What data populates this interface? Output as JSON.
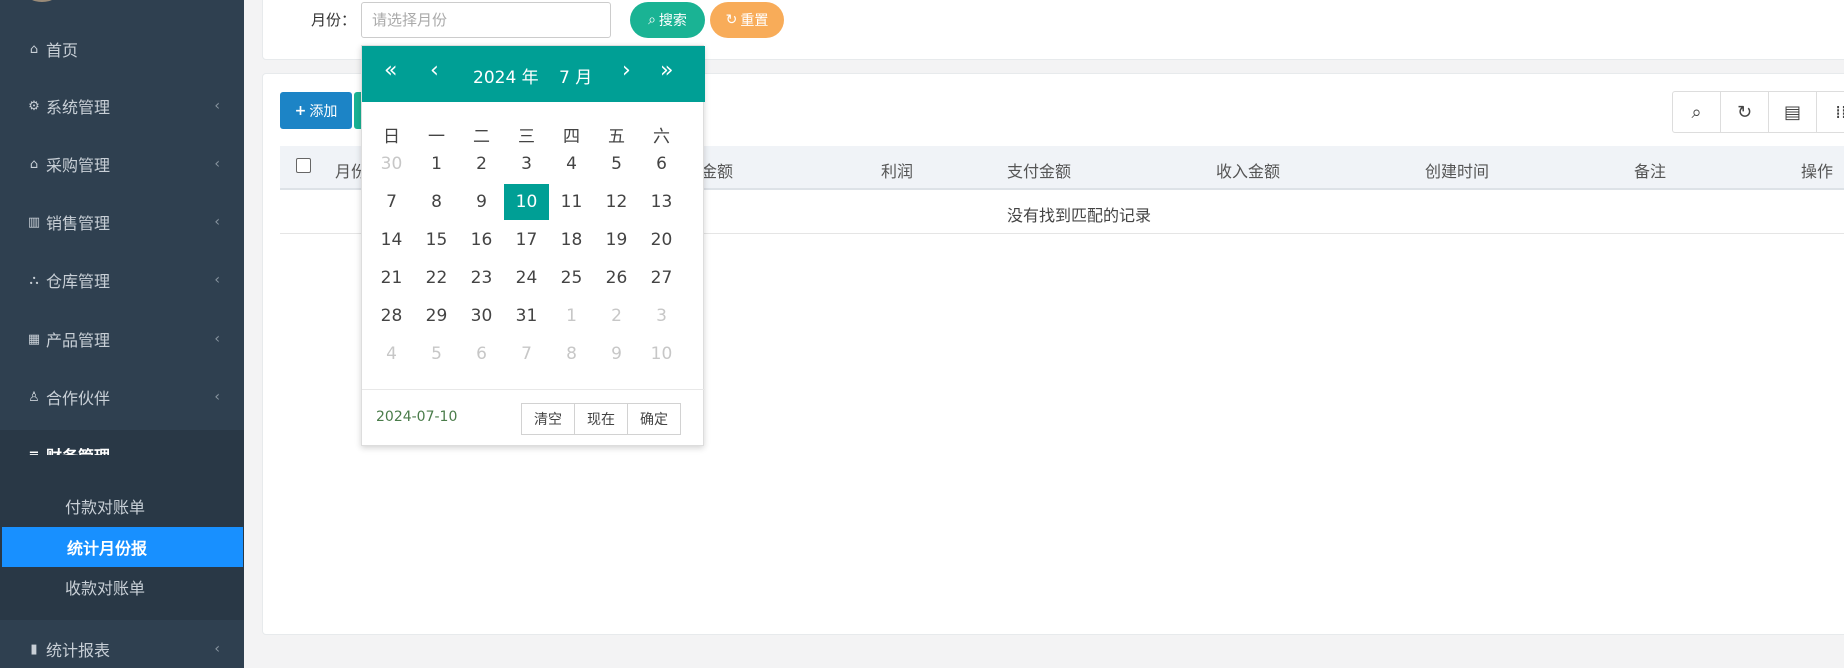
{
  "sidebar": {
    "items": [
      {
        "label": "首页",
        "icon": "home-icon",
        "glyph": "⌂"
      },
      {
        "label": "系统管理",
        "icon": "gear-icon",
        "glyph": "⚙"
      },
      {
        "label": "采购管理",
        "icon": "bank-icon",
        "glyph": "⌂"
      },
      {
        "label": "销售管理",
        "icon": "barcode-icon",
        "glyph": "▥"
      },
      {
        "label": "仓库管理",
        "icon": "binoculars-icon",
        "glyph": "⛬"
      },
      {
        "label": "产品管理",
        "icon": "calculator-icon",
        "glyph": "▦"
      },
      {
        "label": "合作伙伴",
        "icon": "person-icon",
        "glyph": "♙"
      },
      {
        "label": "财务管理",
        "icon": "bars-icon",
        "glyph": "≡"
      },
      {
        "label": "统计报表",
        "icon": "bar-chart-icon",
        "glyph": "▮"
      }
    ],
    "finance_sub": [
      "付款对账单",
      "统计月份报",
      "收款对账单"
    ],
    "chevron_collapsed": "‹",
    "chevron_open": "⌄"
  },
  "search": {
    "month_label": "月份：",
    "month_placeholder": "请选择月份",
    "search_label": "搜索",
    "reset_label": "重置",
    "search_glyph": "⌕",
    "reset_glyph": "↻"
  },
  "toolbar": {
    "add_label": "添加",
    "add_glyph": "+",
    "tools": [
      {
        "name": "search-icon",
        "glyph": "⌕"
      },
      {
        "name": "refresh-icon",
        "glyph": "↻"
      },
      {
        "name": "list-icon",
        "glyph": "▤"
      },
      {
        "name": "columns-icon",
        "glyph": "⁞⁞"
      }
    ]
  },
  "table": {
    "columns": [
      "月份",
      "金额",
      "利润",
      "支付金额",
      "收入金额",
      "创建时间",
      "备注",
      "操作"
    ],
    "empty_text": "没有找到匹配的记录"
  },
  "datepicker": {
    "year_label": "2024 年",
    "month_label": "7 月",
    "prev_year": "«",
    "prev_month": "‹",
    "next_month": "›",
    "next_year": "»",
    "weekdays": [
      "日",
      "一",
      "二",
      "三",
      "四",
      "五",
      "六"
    ],
    "weeks": [
      [
        "30",
        "1",
        "2",
        "3",
        "4",
        "5",
        "6"
      ],
      [
        "7",
        "8",
        "9",
        "10",
        "11",
        "12",
        "13"
      ],
      [
        "14",
        "15",
        "16",
        "17",
        "18",
        "19",
        "20"
      ],
      [
        "21",
        "22",
        "23",
        "24",
        "25",
        "26",
        "27"
      ],
      [
        "28",
        "29",
        "30",
        "31",
        "1",
        "2",
        "3"
      ],
      [
        "4",
        "5",
        "6",
        "7",
        "8",
        "9",
        "10"
      ]
    ],
    "selected_day": "10",
    "current_date": "2024-07-10",
    "btn_clear": "清空",
    "btn_now": "现在",
    "btn_confirm": "确定"
  },
  "colors": {
    "sidebar_bg": "#2f4050",
    "active_menu": "#1890ff",
    "teal": "#009f95",
    "search_btn": "#1ab394",
    "reset_btn": "#f8ac59",
    "add_btn": "#1c84c6"
  }
}
